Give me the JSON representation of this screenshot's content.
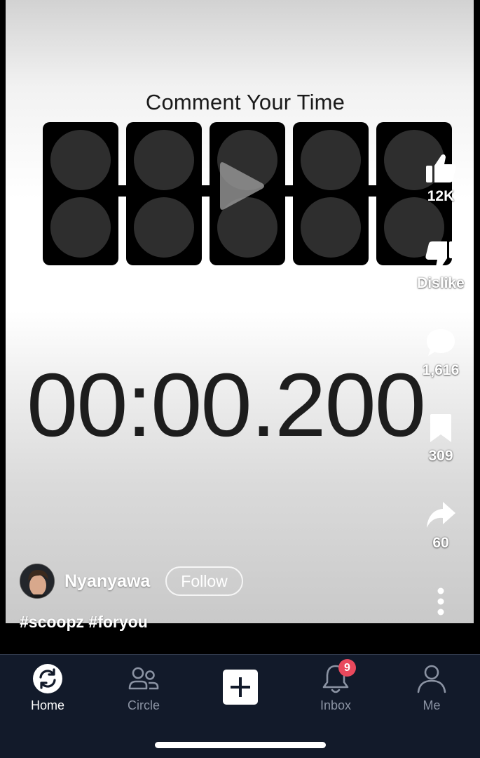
{
  "video": {
    "title": "Comment Your Time",
    "timer": "00:00.200",
    "light_count": 5
  },
  "actions": {
    "like_count": "12K",
    "dislike_label": "Dislike",
    "comment_count": "1,616",
    "save_count": "309",
    "share_count": "60"
  },
  "creator": {
    "username": "Nyanyawa",
    "follow_label": "Follow"
  },
  "caption": "#scoopz #foryou",
  "nav": {
    "home": "Home",
    "circle": "Circle",
    "inbox": "Inbox",
    "inbox_badge": "9",
    "me": "Me"
  },
  "colors": {
    "nav_background": "#121a2a",
    "badge": "#e9495d",
    "video_dark_element": "#000000"
  },
  "icons": {
    "like": "thumbs-up-icon",
    "dislike": "thumbs-down-icon",
    "comment": "speech-bubble-icon",
    "save": "bookmark-icon",
    "share": "share-arrow-icon",
    "more": "more-vertical-icon",
    "home": "refresh-home-icon",
    "circle": "people-icon",
    "create": "plus-icon",
    "inbox": "bell-icon",
    "me": "user-icon"
  }
}
